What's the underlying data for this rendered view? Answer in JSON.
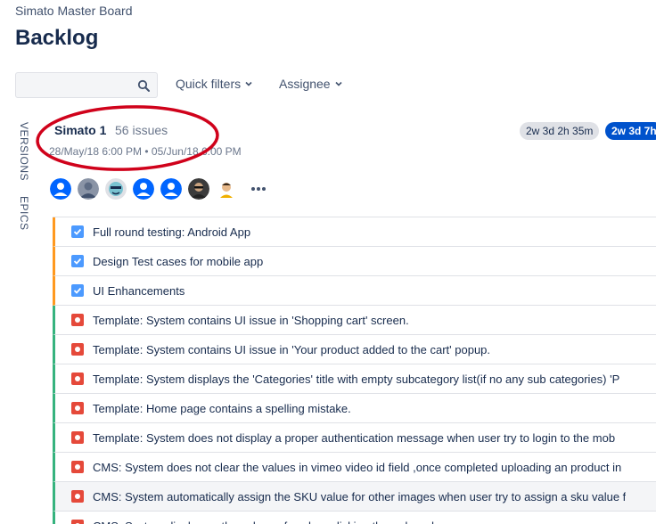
{
  "header": {
    "breadcrumb": "Simato Master Board",
    "title": "Backlog"
  },
  "toolbar": {
    "search_value": "",
    "quick_filters_label": "Quick filters",
    "assignee_label": "Assignee"
  },
  "side_tabs": {
    "versions": "VERSIONS",
    "epics": "EPICS"
  },
  "sprint": {
    "name": "Simato 1",
    "issue_count": "56 issues",
    "dates": "28/May/18 6:00 PM • 05/Jun/18 6:00 PM",
    "badges": [
      "2w 3d 2h 35m",
      "2w 3d 7h"
    ]
  },
  "colors": {
    "story": "#ff991f",
    "bug": "#36b37e",
    "task_icon": "#4c9aff",
    "bug_icon": "#e5493a",
    "annotation": "#d0021b"
  },
  "issues": [
    {
      "type": "task",
      "summary": "Full round testing: Android App"
    },
    {
      "type": "task",
      "summary": "Design Test cases for mobile app"
    },
    {
      "type": "task",
      "summary": "UI Enhancements"
    },
    {
      "type": "bug",
      "summary": "Template: System contains UI issue in 'Shopping cart' screen."
    },
    {
      "type": "bug",
      "summary": "Template: System contains UI issue in 'Your product added to the cart' popup."
    },
    {
      "type": "bug",
      "summary": "Template: System displays the 'Categories' title with empty subcategory list(if no any sub categories) 'P"
    },
    {
      "type": "bug",
      "summary": "Template: Home page contains a spelling mistake."
    },
    {
      "type": "bug",
      "summary": "Template: System does not display a proper authentication message when user try to login to the mob"
    },
    {
      "type": "bug",
      "summary": "CMS: System does not clear the values in vimeo video id field ,once completed uploading an product in"
    },
    {
      "type": "bug",
      "summary": "CMS: System automatically assign the SKU value for other images when user try to assign a sku value f"
    },
    {
      "type": "bug",
      "summary": "CMS: System displays... the values of... when clicking the... drop down... "
    }
  ]
}
